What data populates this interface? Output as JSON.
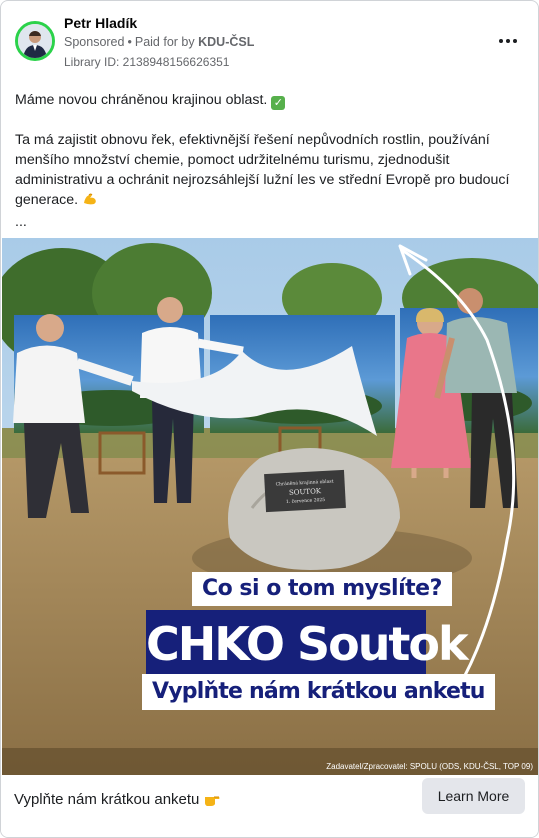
{
  "header": {
    "author": "Petr Hladík",
    "sponsored_label": "Sponsored",
    "paid_prefix": "Paid for by",
    "paid_by": "KDU-ČSL",
    "library_id": "Library ID: 2138948156626351"
  },
  "post": {
    "line1": "Máme novou chráněnou krajinou oblast.",
    "paragraph": "Ta má zajistit obnovu řek, efektivnější řešení nepůvodních rostlin, používání menšího množství chemie, pomoct udržitelnému turismu, zjednodušit administrativu a ochránit nejrozsáhlejší lužní les ve střední Evropě pro budoucí generace.",
    "ellipsis": "..."
  },
  "image": {
    "banner_question": "Co si o tom myslíte?",
    "banner_main": "CHKO Soutok",
    "banner_sub": "Vyplňte nám krátkou anketu",
    "plaque_line1": "Chráněná krajinná oblast",
    "plaque_line2": "SOUTOK",
    "plaque_line3": "1. července 2025",
    "credit": "Zadavatel/Zpracovatel: SPOLU (ODS, KDU-ČSL, TOP 09)"
  },
  "footer": {
    "cta_text": "Vyplňte nám krátkou anketu",
    "button_label": "Learn More"
  },
  "icons": {
    "check": "check-mark-emoji-icon",
    "muscle": "flexed-biceps-emoji-icon",
    "pointing": "pointing-hand-emoji-icon",
    "more": "more-options-icon"
  },
  "colors": {
    "avatar_ring": "#2bd24a",
    "banner_navy": "#16207a",
    "button_bg": "#e4e6eb"
  }
}
